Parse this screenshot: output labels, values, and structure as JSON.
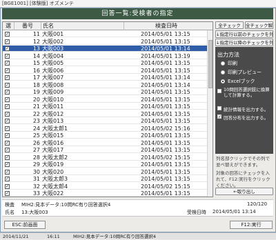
{
  "window": {
    "title": "[BGE1001] [体験版] オズメンテ"
  },
  "header": {
    "title": "回答一覧:受検者の指定"
  },
  "list": {
    "columns": {
      "select": "選",
      "number": "番号",
      "name": "氏名",
      "date": "検査日時"
    },
    "rows": [
      {
        "checked": true,
        "no": "11",
        "name": "大阪001",
        "date": "2014/05/01 13:15",
        "selected": false
      },
      {
        "checked": true,
        "no": "12",
        "name": "大阪002",
        "date": "2014/05/01 13:15",
        "selected": false
      },
      {
        "checked": true,
        "no": "13",
        "name": "大阪003",
        "date": "2014/05/01 13:14",
        "selected": true
      },
      {
        "checked": true,
        "no": "14",
        "name": "大阪004",
        "date": "2014/05/01 13:19",
        "selected": false
      },
      {
        "checked": true,
        "no": "15",
        "name": "大阪005",
        "date": "2014/05/01 13:15",
        "selected": false
      },
      {
        "checked": true,
        "no": "16",
        "name": "大阪006",
        "date": "2014/05/01 13:15",
        "selected": false
      },
      {
        "checked": true,
        "no": "17",
        "name": "大阪007",
        "date": "2014/05/01 13:14",
        "selected": false
      },
      {
        "checked": true,
        "no": "18",
        "name": "大阪008",
        "date": "2014/05/01 13:14",
        "selected": false
      },
      {
        "checked": true,
        "no": "19",
        "name": "大阪009",
        "date": "2014/05/01 13:15",
        "selected": false
      },
      {
        "checked": true,
        "no": "20",
        "name": "大阪010",
        "date": "2014/05/01 13:15",
        "selected": false
      },
      {
        "checked": true,
        "no": "21",
        "name": "大阪011",
        "date": "2014/05/01 13:15",
        "selected": false
      },
      {
        "checked": true,
        "no": "22",
        "name": "大阪012",
        "date": "2014/05/01 13:15",
        "selected": false
      },
      {
        "checked": true,
        "no": "23",
        "name": "大阪013",
        "date": "2014/05/01 13:15",
        "selected": false
      },
      {
        "checked": true,
        "no": "24",
        "name": "大阪太郎1",
        "date": "2014/05/02 15:16",
        "selected": false
      },
      {
        "checked": true,
        "no": "25",
        "name": "大阪015",
        "date": "2014/05/01 13:15",
        "selected": false
      },
      {
        "checked": true,
        "no": "26",
        "name": "大阪016",
        "date": "2014/05/01 13:15",
        "selected": false
      },
      {
        "checked": true,
        "no": "27",
        "name": "大阪017",
        "date": "2014/05/01 13:15",
        "selected": false
      },
      {
        "checked": true,
        "no": "28",
        "name": "大阪太郎2",
        "date": "2014/05/02 15:15",
        "selected": false
      },
      {
        "checked": true,
        "no": "29",
        "name": "大阪019",
        "date": "2014/05/01 13:15",
        "selected": false
      },
      {
        "checked": true,
        "no": "30",
        "name": "大阪020",
        "date": "2014/05/01 13:15",
        "selected": false
      },
      {
        "checked": true,
        "no": "31",
        "name": "大阪太郎3",
        "date": "2014/05/01 13:15",
        "selected": false
      },
      {
        "checked": true,
        "no": "32",
        "name": "大阪太郎4",
        "date": "2014/05/02 15:15",
        "selected": false
      },
      {
        "checked": true,
        "no": "33",
        "name": "大阪022",
        "date": "2014/05/01 13:15",
        "selected": false
      }
    ]
  },
  "right_panel": {
    "check_all": "全チェック",
    "uncheck_all": "全チェック解除",
    "check_after": "↓指定行以前のチェックを外す",
    "uncheck_after": "↓指定行以降のチェックを外す",
    "output_method": "出力方法",
    "opt_print": "印刷",
    "opt_preview": "印刷プレビュー",
    "opt_excel": "Excelブック",
    "opt_10q": "10問回答選択肢に換算して計算する。",
    "opt_stats": "統計情報を出力する。",
    "opt_distribution": "回答分布を出力する。",
    "hint1": "列名部クリックでその列で並べ替えができます。",
    "hint2": "対象の回答にチェックを入れて、F12:実行をクリックください。",
    "retrieve_button": "←取り出し"
  },
  "info": {
    "test_label": "検査",
    "test_value": "MIH2:見本データ:10問RC有り回答選択4",
    "count": "120/120",
    "name_label": "氏名",
    "name_value": "13:大阪003",
    "datetime_label": "受検日時",
    "datetime_value": "2014/05/01 13:14"
  },
  "buttons": {
    "back": "ESC:前画面",
    "execute": "F12:実行"
  },
  "statusbar": {
    "date": "2014/11/21",
    "time": "16:11",
    "info": "MIH2:見本データ:10問RC有り回答選択4"
  }
}
